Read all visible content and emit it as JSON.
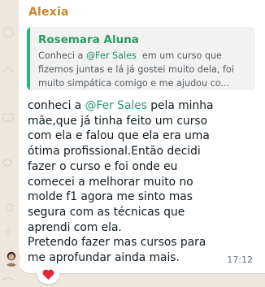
{
  "message": {
    "sender": "Alexia",
    "quote": {
      "author": "Rosemara Aluna",
      "line1_prefix": "Conheci a ",
      "line1_mention": "@Fer Sales",
      "line1_suffix": "  em um curso que",
      "line2": "fizemos juntas e lá já gostei muito dela, foi",
      "line3": "muito simpática comigo e me ajudou co..."
    },
    "body": {
      "line1_prefix": "conheci a ",
      "line1_mention": "@Fer Sales",
      "line1_suffix": " pela minha",
      "line2": "mãe,que já tinha feito um curso",
      "line3": "com ela e falou que ela era uma",
      "line4": "ótima profissional.Então decidi",
      "line5": "fazer o curso e foi onde eu",
      "line6": "comecei a melhorar muito no",
      "line7": "molde f1 agora me sinto mas",
      "line8": "segura com as técnicas que",
      "line9": "aprendi com ela.",
      "line10": "Pretendo fazer mas cursos para",
      "line11": "me aprofundar ainda mais."
    },
    "time": "17:12",
    "reaction_icon": "red-heart-icon",
    "avatar_icon": "user-avatar-icon"
  },
  "colors": {
    "background": "#efe7de",
    "bubble": "#ffffff",
    "sender": "#c4872c",
    "quote_bar": "#2bb673",
    "quote_author": "#2b9a63",
    "mention": "#1f9a6b",
    "heart": "#e8243c"
  }
}
